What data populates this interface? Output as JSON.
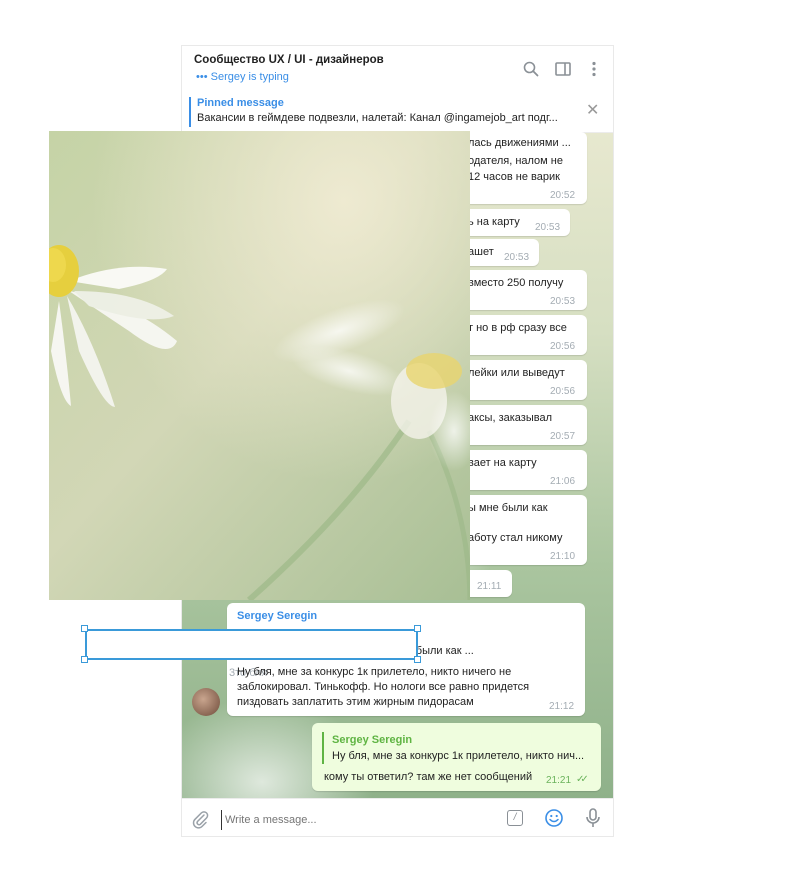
{
  "header": {
    "title": "Сообщество UX / UI - дизайнеров",
    "typing": "••• Sergey is typing",
    "icons": [
      "search-icon",
      "sidebar-icon",
      "more-vertical-icon"
    ]
  },
  "pinned": {
    "title": "Pinned message",
    "text": "Вакансии в геймдеве подвезли, налетай:  Канал @ingamejob_art подг..."
  },
  "messages": [
    {
      "lines": [
        "лась движениями ...",
        "одателя, налом не",
        "12 часов не варик"
      ],
      "time": "20:52"
    },
    {
      "lines": [
        "ь на карту"
      ],
      "time": "20:53"
    },
    {
      "lines": [
        "ашет"
      ],
      "time": "20:53"
    },
    {
      "lines": [
        "вместо 250 получу"
      ],
      "time": "20:53"
    },
    {
      "lines": [
        "т но в рф сразу все"
      ],
      "time": "20:56"
    },
    {
      "lines": [
        "лейки или выведут"
      ],
      "time": "20:56"
    },
    {
      "lines": [
        "аксы, заказывал"
      ],
      "time": "20:57"
    },
    {
      "lines": [
        "вает на карту"
      ],
      "time": "21:06"
    },
    {
      "lines": [
        "ы мне были как",
        "аботу стал никому"
      ],
      "time": "21:10"
    },
    {
      "lines": [],
      "time": "21:11"
    }
  ],
  "sergey_message": {
    "sender": "Sergey Seregin",
    "quote_tail": "и сутулые, вы мне были как ...",
    "line_fragment": "3то бля",
    "lines": [
      "Ну бля, мне за конкурс 1к прилетело, никто ничего не",
      "заблокировал. Тинькофф. Но нологи все равно придется",
      "пиздовать заплатить этим жирным пидорасам"
    ],
    "time": "21:12"
  },
  "my_message": {
    "quote_sender": "Sergey Seregin",
    "quote_text": "Ну бля, мне за конкурс 1к прилетело, никто нич...",
    "text": "кому ты ответил? там же нет сообщений",
    "time": "21:21",
    "status": "✓✓"
  },
  "composer": {
    "placeholder": "Write a message...",
    "command_label": "/",
    "icons": [
      "attach-icon",
      "command-icon",
      "emoji-icon",
      "microphone-icon"
    ]
  },
  "colors": {
    "accent": "#3a8ee6",
    "my_bubble": "#effdde",
    "my_accent": "#5fb443",
    "selection": "#3a9ad9"
  }
}
